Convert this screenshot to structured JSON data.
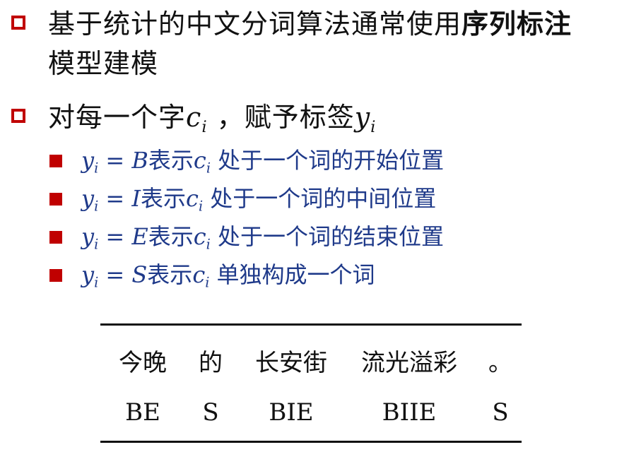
{
  "bullets": [
    {
      "line1_prefix": "基于统计的中文分词算法通常使用",
      "line1_bold": "序列标注",
      "line2": "模型建模"
    },
    {
      "text_before_c": "对每一个字",
      "c_var": "c",
      "c_sub": "i",
      "middle": " ，赋予标签",
      "y_var": "y",
      "y_sub": "i"
    }
  ],
  "tag_rules": [
    {
      "var": "y",
      "sub": "i",
      "eq": " = ",
      "tag": "B",
      "word": "表示",
      "cvar": "c",
      "csub": "i",
      "desc": " 处于一个词的开始位置"
    },
    {
      "var": "y",
      "sub": "i",
      "eq": " = ",
      "tag": "I",
      "word": "表示",
      "cvar": "c",
      "csub": "i",
      "desc": " 处于一个词的中间位置"
    },
    {
      "var": "y",
      "sub": "i",
      "eq": " = ",
      "tag": "E",
      "word": "表示",
      "cvar": "c",
      "csub": "i",
      "desc": " 处于一个词的结束位置"
    },
    {
      "var": "y",
      "sub": "i",
      "eq": " = ",
      "tag": "S",
      "word": "表示",
      "cvar": "c",
      "csub": "i",
      "desc": " 单独构成一个词"
    }
  ],
  "example_table": {
    "words": [
      "今晚",
      "的",
      "长安街",
      "流光溢彩",
      "。"
    ],
    "tags": [
      "BE",
      "S",
      "BIE",
      "BIIE",
      "S"
    ]
  },
  "colors": {
    "bullet_red": "#c00000",
    "rule_text_blue": "#1f3a8a",
    "text_black": "#111111"
  }
}
